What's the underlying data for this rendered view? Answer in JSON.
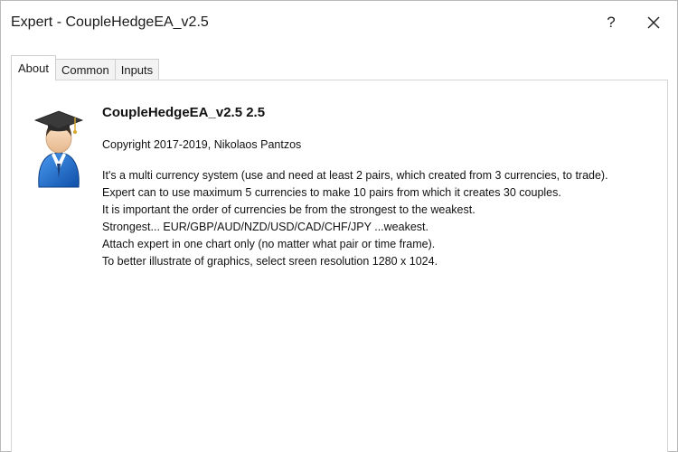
{
  "window": {
    "title": "Expert - CoupleHedgeEA_v2.5",
    "help_label": "?"
  },
  "tabs": [
    {
      "label": "About",
      "active": true
    },
    {
      "label": "Common",
      "active": false
    },
    {
      "label": "Inputs",
      "active": false
    }
  ],
  "about": {
    "ea_title": "CoupleHedgeEA_v2.5 2.5",
    "copyright": "Copyright 2017-2019, Nikolaos Pantzos",
    "description_lines": [
      "It's a multi currency system (use and need at least 2 pairs, which created from 3 currencies, to trade).",
      "Expert can to use maximum 5 currencies to make 10 pairs from which it creates 30 couples.",
      "It is important the order of currencies be from the strongest to the weakest.",
      "Strongest... EUR/GBP/AUD/NZD/USD/CAD/CHF/JPY ...weakest.",
      "Attach expert in one chart only (no matter what pair or time frame).",
      "To better illustrate of graphics, select sreen resolution 1280 x 1024."
    ]
  },
  "icons": {
    "avatar": "graduate-user-icon",
    "close": "close-icon"
  },
  "colors": {
    "avatar_body": "#1d6fd1",
    "avatar_cap": "#3a3a3a"
  }
}
